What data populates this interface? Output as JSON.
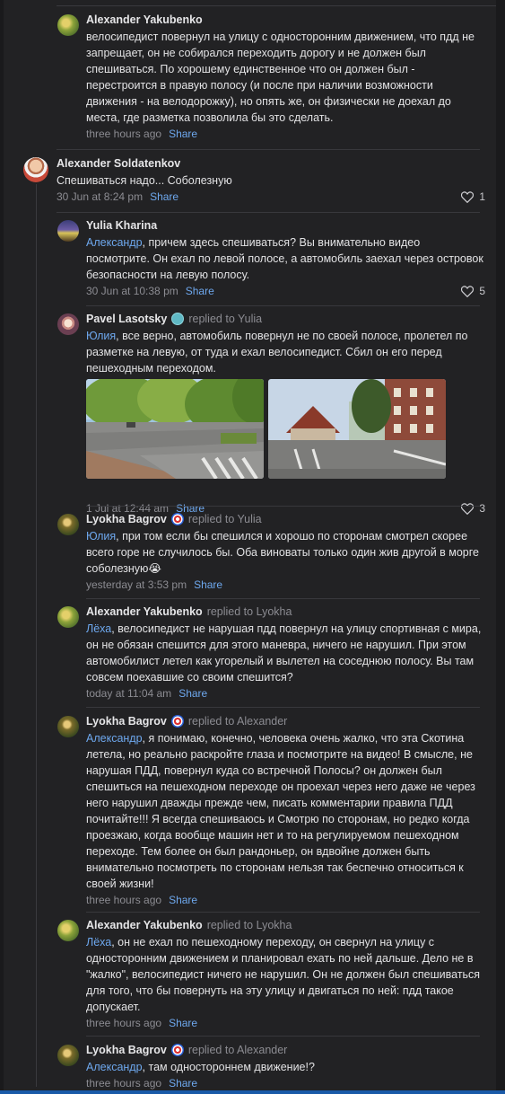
{
  "comments": [
    {
      "author": "Alexander Yakubenko",
      "replied": "",
      "text": "велосипедист повернул на улицу с односторонним движением, что пдд не запрещает, он не собирался переходить дорогу и не должен был спешиваться. По хорошему единственное что он должен был - перестроится в правую полосу (и после при наличии возможности движения - на велодорожку), но опять же, он физически не доехал до места, где разметка позволила бы это сделать.",
      "time": "three hours ago",
      "share": "Share"
    },
    {
      "author": "Alexander Soldatenkov",
      "replied": "",
      "text": "Спешиваться надо... Соболезную",
      "time": "30 Jun at 8:24 pm",
      "share": "Share",
      "likes": "1"
    },
    {
      "author": "Yulia Kharina",
      "replied": "",
      "mention": "Александр",
      "text": ", причем здесь спешиваться? Вы внимательно видео посмотрите. Он ехал по левой полосе, а автомобиль заехал через островок безопасности на левую полосу.",
      "time": "30 Jun at 10:38 pm",
      "share": "Share",
      "likes": "5"
    },
    {
      "author": "Pavel Lasotsky",
      "replied": "replied to Yulia",
      "mention": "Юлия",
      "text": ", все верно, автомобиль повернул не по своей полосе, пролетел по разметке на левую, от туда и ехал велосипедист. Сбил он его перед пешеходным переходом.",
      "time": "1 Jul at 12:44 am",
      "share": "Share",
      "likes": "3"
    },
    {
      "author": "Lyokha Bagrov",
      "replied": "replied to Yulia",
      "mention": "Юлия",
      "text": ", при том если бы спешился и хорошо по сторонам смотрел скорее всего горе не случилось бы. Оба виноваты только один жив другой в морге соболезную😭",
      "time": "yesterday at 3:53 pm",
      "share": "Share"
    },
    {
      "author": "Alexander Yakubenko",
      "replied": "replied to Lyokha",
      "mention": "Лёха",
      "text": ", велосипедист не нарушая пдд повернул на улицу спортивная с мира, он не обязан спешится для этого маневра, ничего не нарушил. При этом автомобилист летел как угорелый и вылетел на соседнюю полосу. Вы там совсем поехавшие со своим спешится?",
      "time": "today at 11:04 am",
      "share": "Share"
    },
    {
      "author": "Lyokha Bagrov",
      "replied": "replied to Alexander",
      "mention": "Александр",
      "text": ", я понимаю, конечно, человека очень жалко, что эта Скотина летела, но реально раскройте глаза и посмотрите на видео! В смысле, не нарушая ПДД, повернул куда со встречной Полосы? он должен был спешиться на пешеходном переходе он проехал через него даже не через него нарушил дважды прежде чем, писать комментарии правила ПДД почитайте!!! Я всегда спешиваюсь и Смотрю по сторонам, но редко когда проезжаю, когда вообще машин нет и то на регулируемом пешеходном переходе. Тем более он был рандоньер, он вдвойне должен быть внимательно посмотреть по сторонам нельзя так беспечно относиться к своей жизни!",
      "time": "three hours ago",
      "share": "Share"
    },
    {
      "author": "Alexander Yakubenko",
      "replied": "replied to Lyokha",
      "mention": "Лёха",
      "text": ", он не ехал по пешеходному переходу, он свернул на улицу с односторонним движением и планировал ехать по ней дальше. Дело не в \"жалко\", велосипедист ничего не нарушил. Он не должен был спешиваться для того, что бы повернуть на эту улицу и двигаться по ней: пдд такое допускает.",
      "time": "three hours ago",
      "share": "Share"
    },
    {
      "author": "Lyokha Bagrov",
      "replied": "replied to Alexander",
      "mention": "Александр",
      "text": ", там одностороннем движение!?",
      "time": "three hours ago",
      "share": "Share"
    }
  ],
  "icons": {
    "like": "heart-icon",
    "shield": "shield-badge-icon",
    "bot": "bot-badge-icon"
  },
  "colors": {
    "background": "#222224",
    "accent": "#6ea8ee",
    "muted": "#8c8c92"
  }
}
